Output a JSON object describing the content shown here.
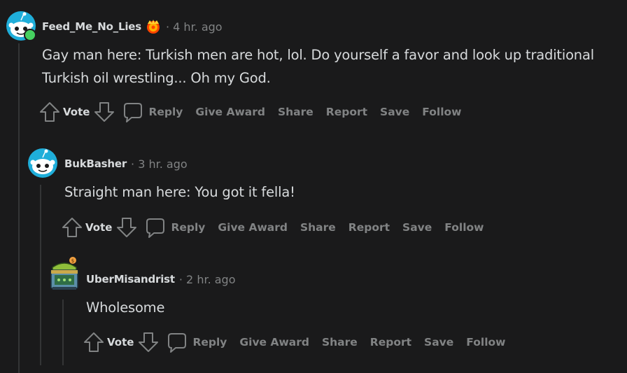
{
  "comments": [
    {
      "username": "Feed_Me_No_Lies",
      "time": "4 hr. ago",
      "avatar_icon": "snoo-avatar-icon",
      "flair_icon": "award-crown-icon",
      "body": "Gay man here: Turkish men are hot, lol. Do yourself a favor and look up traditional Turkish oil wrestling... Oh my God.",
      "actions": {
        "vote": "Vote",
        "reply": "Reply",
        "award": "Give Award",
        "share": "Share",
        "report": "Report",
        "save": "Save",
        "follow": "Follow"
      }
    },
    {
      "username": "BukBasher",
      "time": "3 hr. ago",
      "avatar_icon": "snoo-avatar-icon",
      "body": "Straight man here: You got it fella!",
      "actions": {
        "vote": "Vote",
        "reply": "Reply",
        "award": "Give Award",
        "share": "Share",
        "report": "Report",
        "save": "Save",
        "follow": "Follow"
      }
    },
    {
      "username": "UberMisandrist",
      "time": "2 hr. ago",
      "avatar_icon": "treasure-chest-avatar-icon",
      "body": "Wholesome",
      "actions": {
        "vote": "Vote",
        "reply": "Reply",
        "award": "Give Award",
        "share": "Share",
        "report": "Report",
        "save": "Save",
        "follow": "Follow"
      }
    }
  ],
  "colors": {
    "background": "#1a1a1b",
    "text": "#d7dadc",
    "muted": "#818384",
    "thread_line": "#343536",
    "online": "#46d160",
    "avatar_blue": "#1faeda"
  }
}
